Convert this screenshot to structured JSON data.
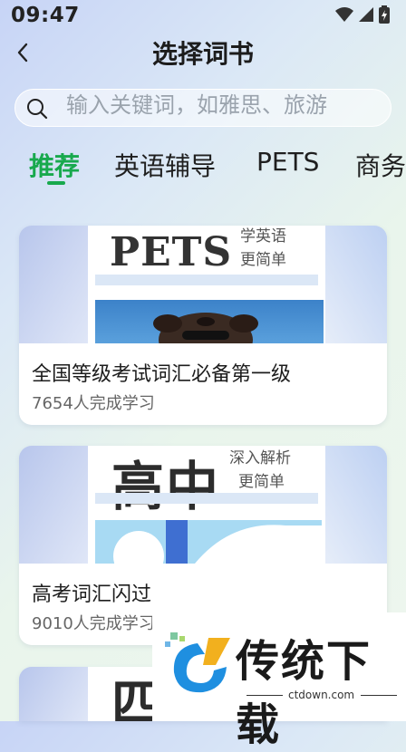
{
  "status_bar": {
    "time": "09:47"
  },
  "header": {
    "title": "选择词书"
  },
  "search": {
    "placeholder": "输入关键词，如雅思、旅游"
  },
  "tabs": [
    {
      "label": "推荐",
      "active": true
    },
    {
      "label": "英语辅导",
      "active": false
    },
    {
      "label": "PETS",
      "active": false
    },
    {
      "label": "商务",
      "active": false
    }
  ],
  "books": [
    {
      "title": "全国等级考试词汇必备第一级",
      "learners": "7654人完成学习",
      "cover": {
        "big_text": "PETS",
        "tag_line1": "学英语",
        "tag_line2": "更简单"
      }
    },
    {
      "title": "高考词汇闪过",
      "learners": "9010人完成学习",
      "cover": {
        "big_text": "高中",
        "tag_line1": "深入解析",
        "tag_line2": "更简单"
      }
    },
    {
      "title": "",
      "learners": "",
      "cover": {
        "big_text": "四"
      }
    }
  ],
  "watermark": {
    "brand": "传统下载",
    "url": "ctdown.com"
  },
  "colors": {
    "accent": "#18a94d"
  }
}
